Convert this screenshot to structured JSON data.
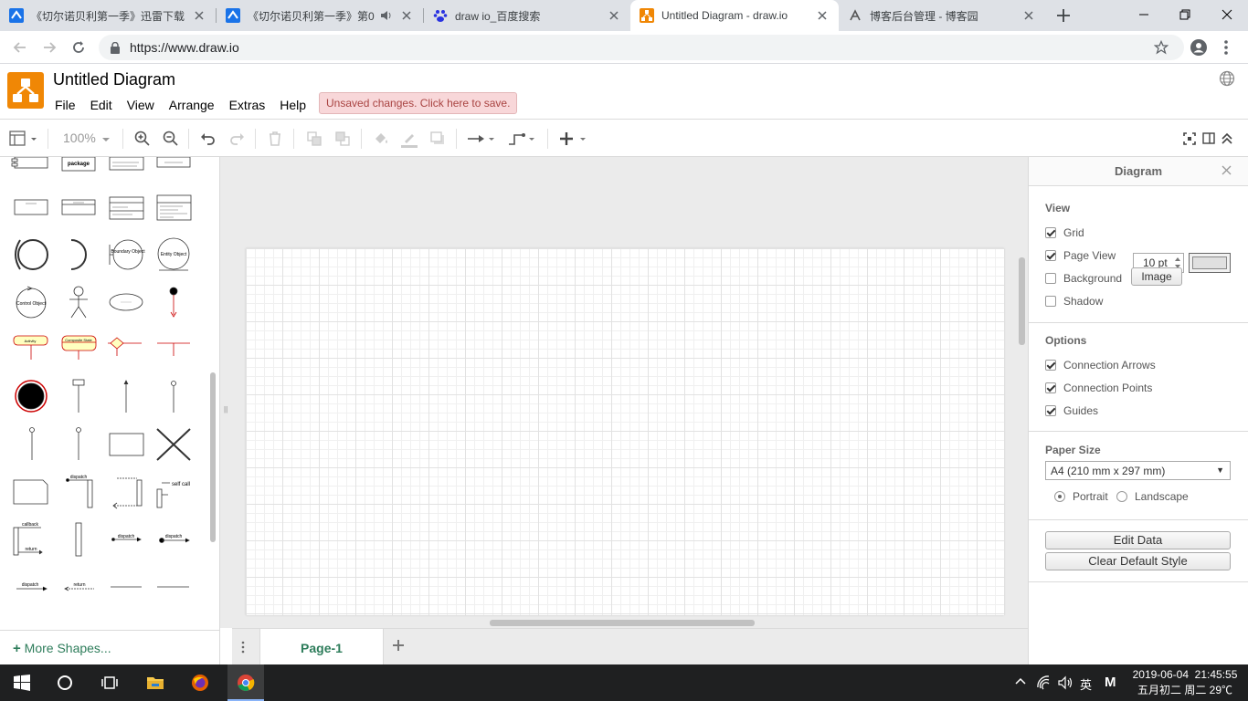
{
  "browser": {
    "tabs": [
      {
        "title": "《切尔诺贝利第一季》迅雷下载",
        "icon": "drawio-favicon"
      },
      {
        "title": "《切尔诺贝利第一季》第0",
        "icon": "drawio-favicon"
      },
      {
        "title": "draw io_百度搜索",
        "icon": "baidu-paw-icon"
      },
      {
        "title": "Untitled Diagram - draw.io",
        "icon": "drawio-favicon",
        "active": true
      },
      {
        "title": "博客后台管理 - 博客园",
        "icon": "cnblogs-icon"
      }
    ],
    "url": "https://www.draw.io"
  },
  "app": {
    "title": "Untitled Diagram",
    "menus": [
      "File",
      "Edit",
      "View",
      "Arrange",
      "Extras",
      "Help"
    ],
    "unsaved": "Unsaved changes. Click here to save.",
    "zoom": "100%"
  },
  "sidebar": {
    "more_shapes": "More Shapes...",
    "shape_labels": {
      "package": "package",
      "boundary": "Boundary Object",
      "entity": "Entity Object",
      "control": "Control Object",
      "activity": "Activity",
      "subactivity": "Composite State",
      "dispatch": "dispatch",
      "callback": "callback",
      "return": "return",
      "self_call": "self call"
    }
  },
  "canvas": {
    "page_tab": "Page-1"
  },
  "format_panel": {
    "title": "Diagram",
    "view_title": "View",
    "grid_label": "Grid",
    "grid_size": "10 pt",
    "page_view_label": "Page View",
    "background_label": "Background",
    "image_button": "Image",
    "shadow_label": "Shadow",
    "options_title": "Options",
    "connection_arrows": "Connection Arrows",
    "connection_points": "Connection Points",
    "guides": "Guides",
    "paper_size_title": "Paper Size",
    "paper_size_value": "A4 (210 mm x 297 mm)",
    "portrait": "Portrait",
    "landscape": "Landscape",
    "edit_data": "Edit Data",
    "clear_default_style": "Clear Default Style",
    "checks": {
      "grid": true,
      "page_view": true,
      "background": false,
      "shadow": false,
      "connection_arrows": true,
      "connection_points": true,
      "guides": true
    },
    "orientation": "portrait"
  },
  "taskbar": {
    "ime": "英",
    "ime2": "M",
    "date": "2019-06-04",
    "time": "21:45:55",
    "lunar": "五月初二 周二 29℃"
  }
}
